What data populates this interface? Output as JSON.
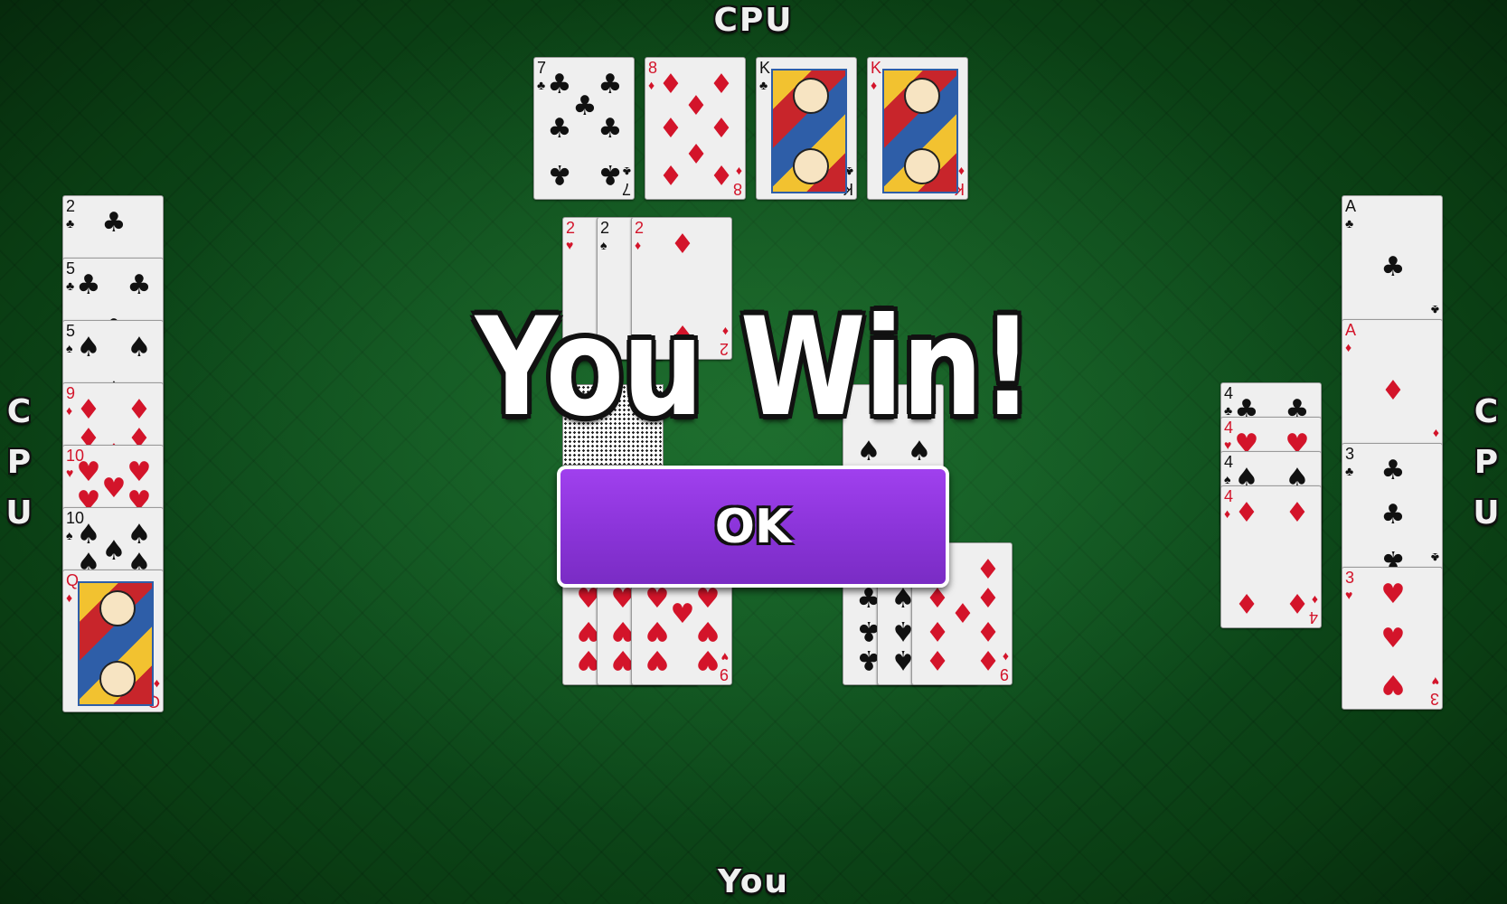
{
  "players": {
    "top": "CPU",
    "left": "CPU",
    "right": "CPU",
    "bottom": "You"
  },
  "result": {
    "banner": "You Win!",
    "ok_label": "OK"
  },
  "colors": {
    "table": "#0c4a15",
    "ok_button": "#8a34d8",
    "card_red": "#d3142a"
  },
  "hands": {
    "top": [
      {
        "rank": "7",
        "suit": "clubs"
      },
      {
        "rank": "8",
        "suit": "diamonds"
      },
      {
        "rank": "K",
        "suit": "clubs"
      },
      {
        "rank": "K",
        "suit": "diamonds"
      }
    ],
    "left": [
      {
        "rank": "2",
        "suit": "clubs"
      },
      {
        "rank": "5",
        "suit": "clubs"
      },
      {
        "rank": "5",
        "suit": "spades"
      },
      {
        "rank": "9",
        "suit": "diamonds"
      },
      {
        "rank": "10",
        "suit": "hearts"
      },
      {
        "rank": "10",
        "suit": "spades"
      },
      {
        "rank": "Q",
        "suit": "diamonds"
      }
    ],
    "right_inner": [
      {
        "rank": "4",
        "suit": "clubs"
      },
      {
        "rank": "4",
        "suit": "hearts"
      },
      {
        "rank": "4",
        "suit": "spades"
      },
      {
        "rank": "4",
        "suit": "diamonds"
      }
    ],
    "right_outer": [
      {
        "rank": "A",
        "suit": "clubs"
      },
      {
        "rank": "A",
        "suit": "diamonds"
      },
      {
        "rank": "3",
        "suit": "clubs"
      },
      {
        "rank": "3",
        "suit": "hearts"
      }
    ]
  },
  "melds": {
    "top_center": [
      {
        "rank": "2",
        "suit": "hearts"
      },
      {
        "rank": "2",
        "suit": "spades"
      },
      {
        "rank": "2",
        "suit": "diamonds"
      }
    ],
    "bottom_left": [
      {
        "rank": "9",
        "suit": "hearts"
      },
      {
        "rank": "9",
        "suit": "hearts"
      },
      {
        "rank": "9",
        "suit": "hearts"
      }
    ],
    "bottom_right": [
      {
        "rank": "9",
        "suit": "clubs"
      },
      {
        "rank": "9",
        "suit": "spades"
      },
      {
        "rank": "9",
        "suit": "diamonds"
      }
    ]
  }
}
